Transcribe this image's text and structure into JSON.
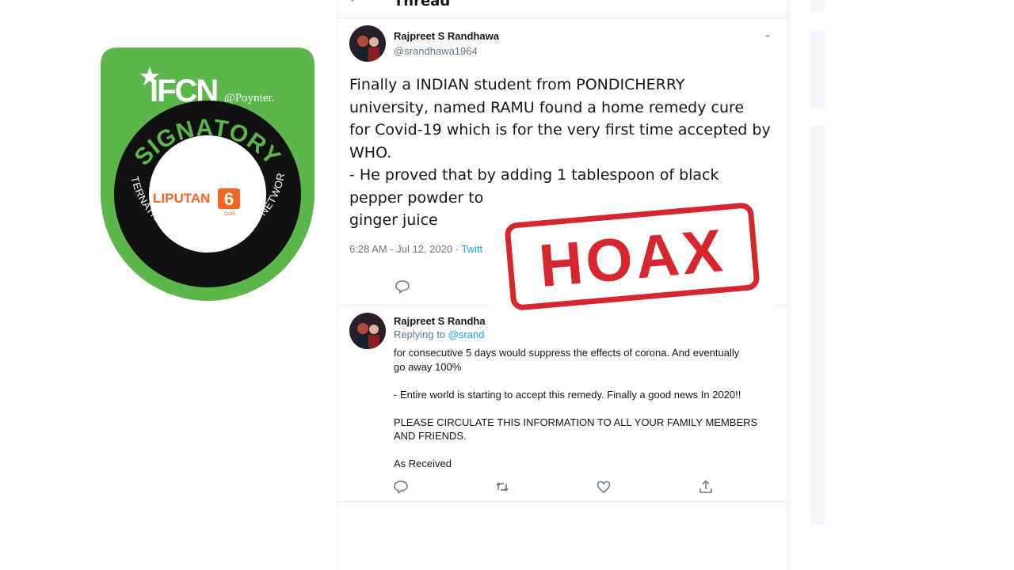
{
  "badge": {
    "brand": "IFCN",
    "by": "@Poynter.",
    "ring_top": "SIGNATORY",
    "ring_bottom": "INTERNATIONAL FACT-CHECKING NETWORK",
    "member_logo_text": "LIPUTAN",
    "member_logo_number": "6",
    "member_logo_suffix": ".COM",
    "colors": {
      "green": "#5bb74a",
      "ring": "#111111",
      "orange": "#f26522"
    }
  },
  "header": {
    "back_icon": "arrow-left-icon",
    "title": "Thread"
  },
  "tweet": {
    "author_name": "Rajpreet S Randhawa",
    "author_handle": "@srandhawa1964",
    "text_lines": [
      "Finally a INDIAN student from PONDICHERRY",
      "university, named RAMU  found a home remedy cure",
      "for Covid-19 which is for the very first time accepted by",
      "WHO.",
      "- He proved that by adding 1 tablespoon of black",
      "pepper powder to",
      "ginger juice"
    ],
    "timestamp": "6:28 AM - Jul 12, 2020 · ",
    "source": "Twitt",
    "menu_icon": "chevron-down-icon",
    "reply_icon": "reply-icon"
  },
  "reply": {
    "author_name": "Rajpreet S Randha",
    "replying_label": "Replying to ",
    "replying_mention": "@srand",
    "lines": [
      "for consecutive 5 days would suppress the effects of corona. And eventually",
      "go away 100%",
      "",
      "- Entire world is starting to accept this remedy. Finally a good news In 2020!!",
      "",
      "PLEASE CIRCULATE THIS INFORMATION TO ALL YOUR FAMILY MEMBERS",
      "AND FRIENDS.",
      "",
      "As Received"
    ],
    "actions": [
      "reply-icon",
      "retweet-icon",
      "like-icon",
      "share-icon"
    ]
  },
  "stamp": {
    "text": "HOAX",
    "color": "#d8262e"
  }
}
